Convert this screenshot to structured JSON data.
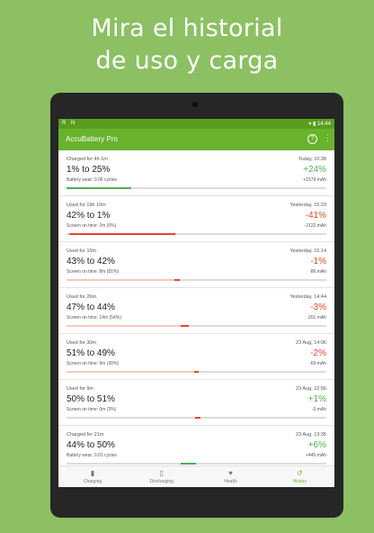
{
  "headline": {
    "line1": "Mira el historial",
    "line2": "de uso y carga"
  },
  "status_bar": {
    "left_icons": "R N",
    "time": "14:44",
    "right_icons": "▾ ▮"
  },
  "app_bar": {
    "title": "AccuBattery Pro",
    "help_icon": "?",
    "more_icon": "⋮"
  },
  "sessions": [
    {
      "subtitle": "Charged for 4h 1m",
      "time": "Today, 10:38",
      "range": "1% to 25%",
      "change": "+24%",
      "change_type": "charge",
      "detail": "Battery wear: 0.06 cycles",
      "mah": "+1579 mAh",
      "bar_start": 0.0,
      "bar_end": 0.25,
      "bar_color": "#4caf50"
    },
    {
      "subtitle": "Used for 19h 10m",
      "time": "Yesterday, 15:29",
      "range": "42% to 1%",
      "change": "-41%",
      "change_type": "discharge",
      "detail": "Screen on time: 2m (0%)",
      "mah": "-2122 mAh",
      "bar_start": 0.01,
      "bar_end": 0.42,
      "bar_color": "#e8462b"
    },
    {
      "subtitle": "Used for 10m",
      "time": "Yesterday, 15:14",
      "range": "43% to 42%",
      "change": "-1%",
      "change_type": "discharge",
      "detail": "Screen on time: 8m (81%)",
      "mah": "-86 mAh",
      "bar_start": 0.42,
      "bar_end": 0.43,
      "bar_color": "#e8462b"
    },
    {
      "subtitle": "Used for 26m",
      "time": "Yesterday, 14:44",
      "range": "47% to 44%",
      "change": "-3%",
      "change_type": "discharge",
      "detail": "Screen on time: 14m (54%)",
      "mah": "-201 mAh",
      "bar_start": 0.44,
      "bar_end": 0.47,
      "bar_color": "#e8462b"
    },
    {
      "subtitle": "Used for 30m",
      "time": "23 Aug, 14:06",
      "range": "51% to 49%",
      "change": "-2%",
      "change_type": "discharge",
      "detail": "Screen on time: 9m (30%)",
      "mah": "-69 mAh",
      "bar_start": 0.49,
      "bar_end": 0.51,
      "bar_color": "#e8462b"
    },
    {
      "subtitle": "Used for 9m",
      "time": "23 Aug, 12:56",
      "range": "50% to 51%",
      "change": "+1%",
      "change_type": "charge",
      "detail": "Screen on time: 0m (3%)",
      "mah": "-3 mAh",
      "bar_start": 0.5,
      "bar_end": 0.51,
      "bar_color": "#e8462b"
    },
    {
      "subtitle": "Charged for 21m",
      "time": "23 Aug, 13:35",
      "range": "44% to 50%",
      "change": "+6%",
      "change_type": "charge",
      "detail": "Battery wear: 0.01 cycles",
      "mah": "+445 mAh",
      "bar_start": 0.44,
      "bar_end": 0.5,
      "bar_color": "#4caf50"
    }
  ],
  "bottom_nav": [
    {
      "label": "Charging",
      "icon": "battery-charging-icon",
      "glyph": "▮",
      "active": false
    },
    {
      "label": "Discharging",
      "icon": "battery-discharging-icon",
      "glyph": "▯",
      "active": false
    },
    {
      "label": "Health",
      "icon": "heart-icon",
      "glyph": "♥",
      "active": false
    },
    {
      "label": "History",
      "icon": "history-icon",
      "glyph": "↺",
      "active": true
    }
  ],
  "colors": {
    "background": "#8cc063",
    "app_bar": "#68b22c",
    "status_bar": "#5a9e1e",
    "charge": "#4caf50",
    "discharge": "#e8462b",
    "bezel": "#262626"
  }
}
